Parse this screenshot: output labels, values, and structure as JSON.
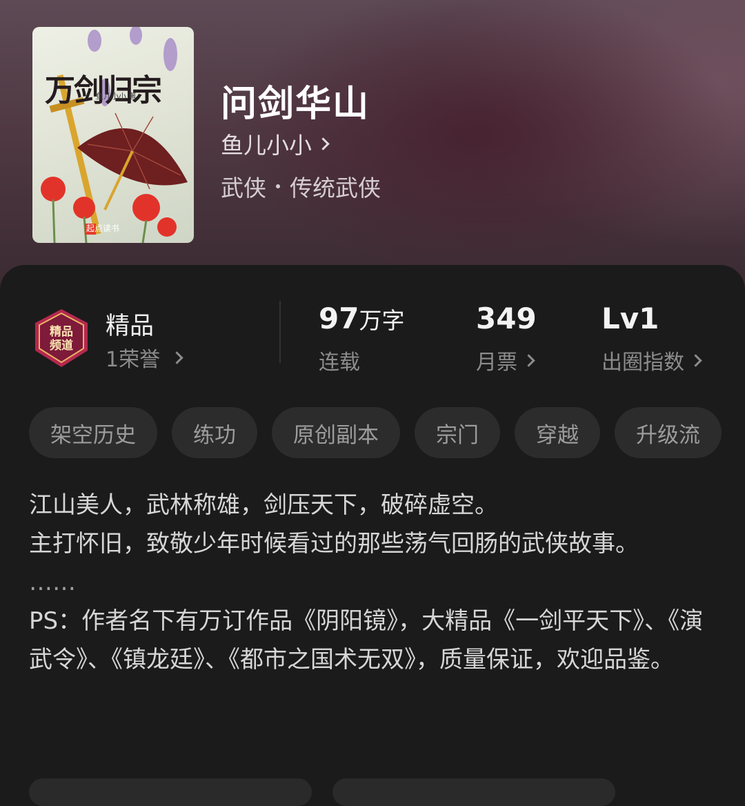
{
  "book": {
    "cover_title": "万剑归宗",
    "cover_author": "鱼儿小小 著",
    "cover_brand": "起点读书",
    "title": "问剑华山",
    "author": "鱼儿小小",
    "genre": "武侠",
    "subgenre": "传统武侠"
  },
  "stats": {
    "badge_text": "精品频道",
    "honor_label": "精品",
    "honor_value": "1荣誉",
    "words_value": "97",
    "words_unit": "万字",
    "words_status": "连载",
    "tickets_value": "349",
    "tickets_label": "月票",
    "index_value": "Lv1",
    "index_label": "出圈指数"
  },
  "tags": [
    "架空历史",
    "练功",
    "原创副本",
    "宗门",
    "穿越",
    "升级流"
  ],
  "description": {
    "line1": "江山美人，武林称雄，剑压天下，破碎虚空。",
    "line2": "主打怀旧，致敬少年时候看过的那些荡气回肠的武侠故事。",
    "ellipsis": "……",
    "line3": "PS：作者名下有万订作品《阴阳镜》，大精品《一剑平天下》、《演武令》、《镇龙廷》、《都市之国术无双》，质量保证，欢迎品鉴。"
  }
}
